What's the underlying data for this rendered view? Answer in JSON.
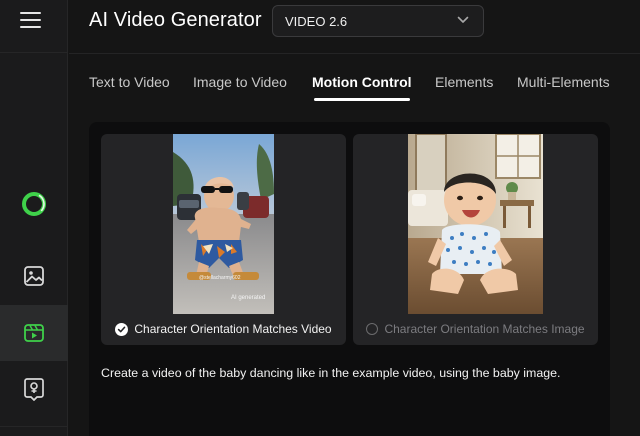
{
  "app": {
    "title": "AI Video Generator",
    "model_select": {
      "value": "VIDEO 2.6"
    }
  },
  "sidebar": {
    "items": [
      {
        "name": "logo",
        "icon": "ring-logo-icon",
        "active": false
      },
      {
        "name": "image",
        "icon": "image-icon",
        "active": false
      },
      {
        "name": "video",
        "icon": "video-clapper-icon",
        "active": true
      },
      {
        "name": "avatar",
        "icon": "avatar-icon",
        "active": false
      }
    ]
  },
  "tabs": [
    {
      "label": "Text to Video",
      "active": false
    },
    {
      "label": "Image to Video",
      "active": false
    },
    {
      "label": "Motion Control",
      "active": true
    },
    {
      "label": "Elements",
      "active": false
    },
    {
      "label": "Multi-Elements",
      "active": false
    }
  ],
  "cards": [
    {
      "name": "reference-video",
      "caption": "Character Orientation Matches Video",
      "selected": true,
      "overlay_handle": "@stellacharmy602",
      "overlay_badge": "AI generated"
    },
    {
      "name": "reference-image",
      "caption": "Character Orientation Matches Image",
      "selected": false
    }
  ],
  "prompt": "Create a video of the baby dancing like in the example video, using the baby image.",
  "colors": {
    "background": "#151515",
    "sidebar": "#1b1b1c",
    "accent_green": "#3fd14a",
    "panel": "#0d0d0e",
    "card": "#242426"
  }
}
